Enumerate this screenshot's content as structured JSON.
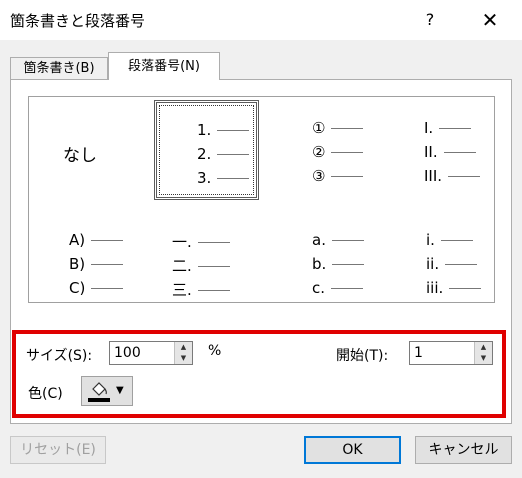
{
  "window": {
    "title": "箇条書きと段落番号",
    "help": "?",
    "close": "✕"
  },
  "tabs": [
    {
      "label": "箇条書き(B)"
    },
    {
      "label": "段落番号(N)"
    }
  ],
  "gallery": {
    "none_label": "なし",
    "cells": [
      [
        "1.",
        "2.",
        "3."
      ],
      [
        "①",
        "②",
        "③"
      ],
      [
        "I.",
        "II.",
        "III."
      ],
      [
        "A)",
        "B)",
        "C)"
      ],
      [
        "一.",
        "二.",
        "三."
      ],
      [
        "a.",
        "b.",
        "c."
      ],
      [
        "i.",
        "ii.",
        "iii."
      ]
    ]
  },
  "size": {
    "label": "サイズ(S):",
    "value": "100",
    "unit": "%"
  },
  "start": {
    "label": "開始(T):",
    "value": "1"
  },
  "color": {
    "label": "色(C)",
    "swatch": "#000000"
  },
  "buttons": {
    "reset": "リセット(E)",
    "ok": "OK",
    "cancel": "キャンセル"
  },
  "highlight_color": "#e00000"
}
